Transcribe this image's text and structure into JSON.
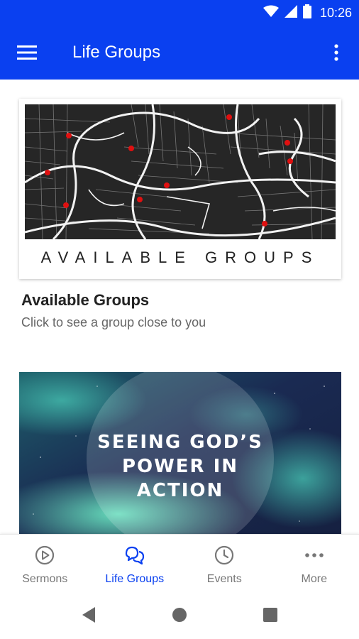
{
  "status_bar": {
    "time": "10:26"
  },
  "app_bar": {
    "title": "Life Groups"
  },
  "cards": [
    {
      "image_caption": "AVAILABLE GROUPS",
      "title": "Available Groups",
      "subtitle": "Click to see a group close to you"
    },
    {
      "image_text_lines": [
        "SEEING GOD’S",
        "POWER IN",
        "ACTION"
      ]
    }
  ],
  "bottom_nav": {
    "items": [
      {
        "label": "Sermons",
        "icon": "play-circle-icon",
        "active": false
      },
      {
        "label": "Life Groups",
        "icon": "chat-bubbles-icon",
        "active": true
      },
      {
        "label": "Events",
        "icon": "clock-icon",
        "active": false
      },
      {
        "label": "More",
        "icon": "more-dots-icon",
        "active": false
      }
    ]
  },
  "colors": {
    "primary": "#0a40f0",
    "nav_inactive": "#777777",
    "map_pin": "#e01010"
  }
}
